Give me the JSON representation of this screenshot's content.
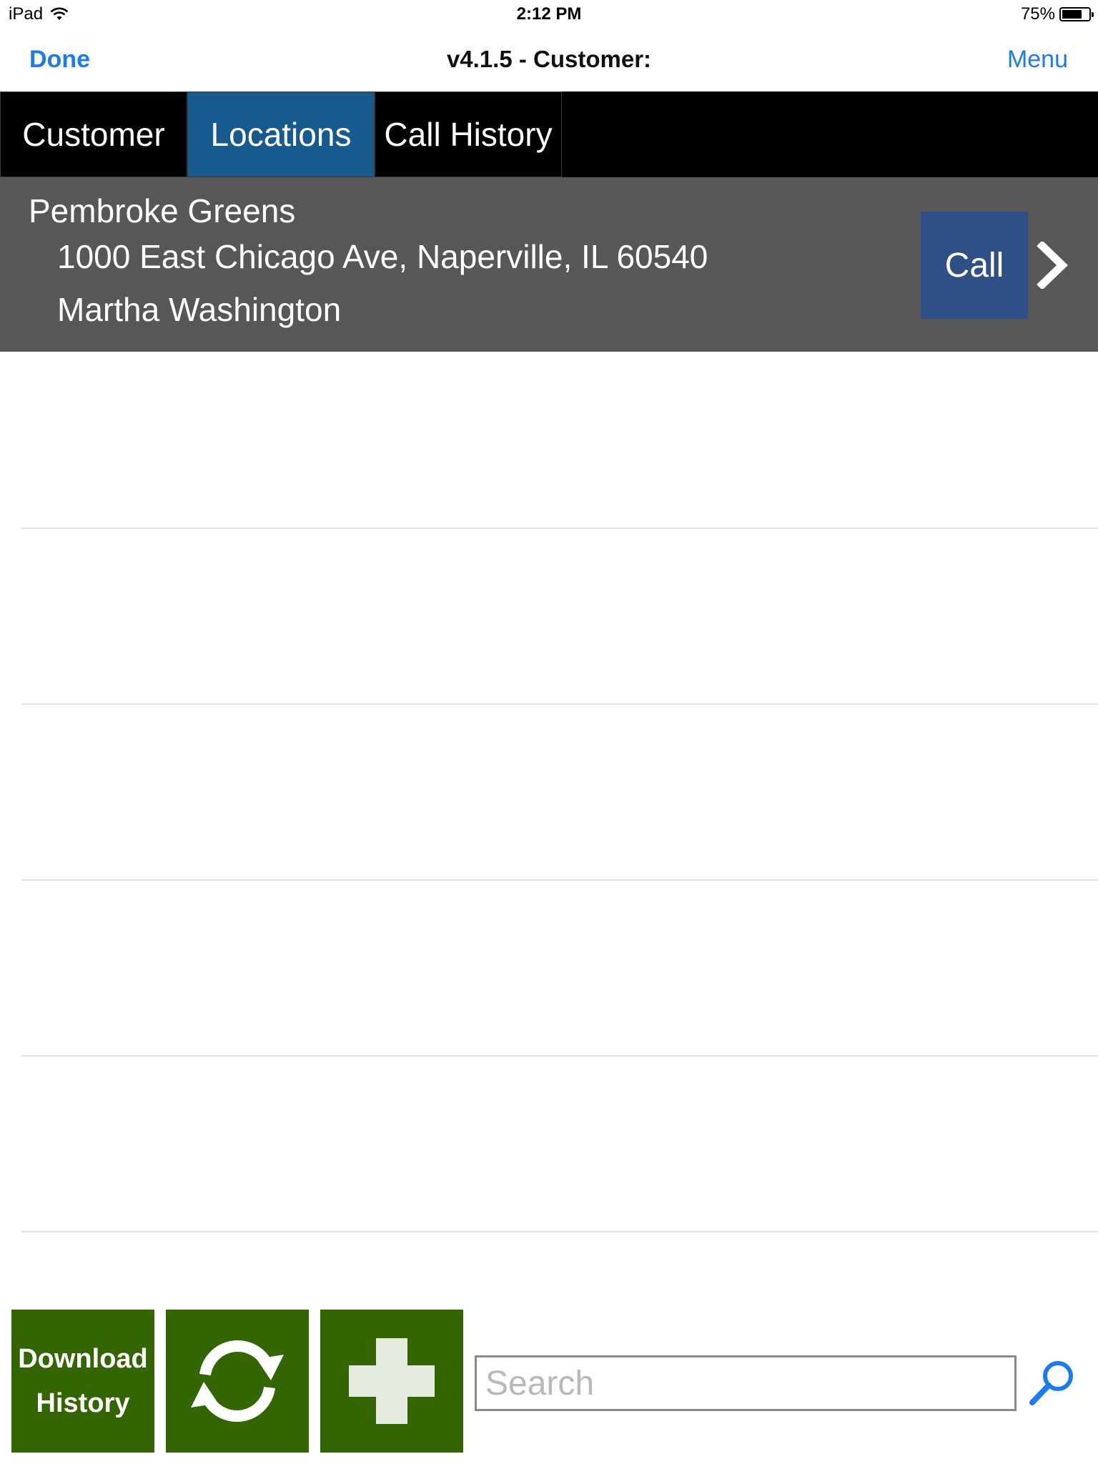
{
  "status_bar": {
    "device": "iPad",
    "time": "2:12 PM",
    "battery_percent": "75%",
    "battery_level": 0.75
  },
  "nav": {
    "done_label": "Done",
    "title": "v4.1.5 - Customer:",
    "menu_label": "Menu"
  },
  "tabs": [
    {
      "label": "Customer",
      "active": false
    },
    {
      "label": "Locations",
      "active": true
    },
    {
      "label": "Call History",
      "active": false
    }
  ],
  "location": {
    "name": "Pembroke Greens",
    "address": "1000 East Chicago Ave, Naperville, IL 60540",
    "contact": "Martha Washington",
    "call_label": "Call"
  },
  "toolbar": {
    "download_line1": "Download",
    "download_line2": "History",
    "refresh_icon": "refresh-icon",
    "add_icon": "plus-icon"
  },
  "search": {
    "placeholder": "Search",
    "value": ""
  },
  "colors": {
    "accent_blue": "#1a7cf0",
    "tab_active": "#175a8e",
    "row_bg": "#575757",
    "call_button": "#2f5087",
    "toolbar_green": "#336600"
  }
}
